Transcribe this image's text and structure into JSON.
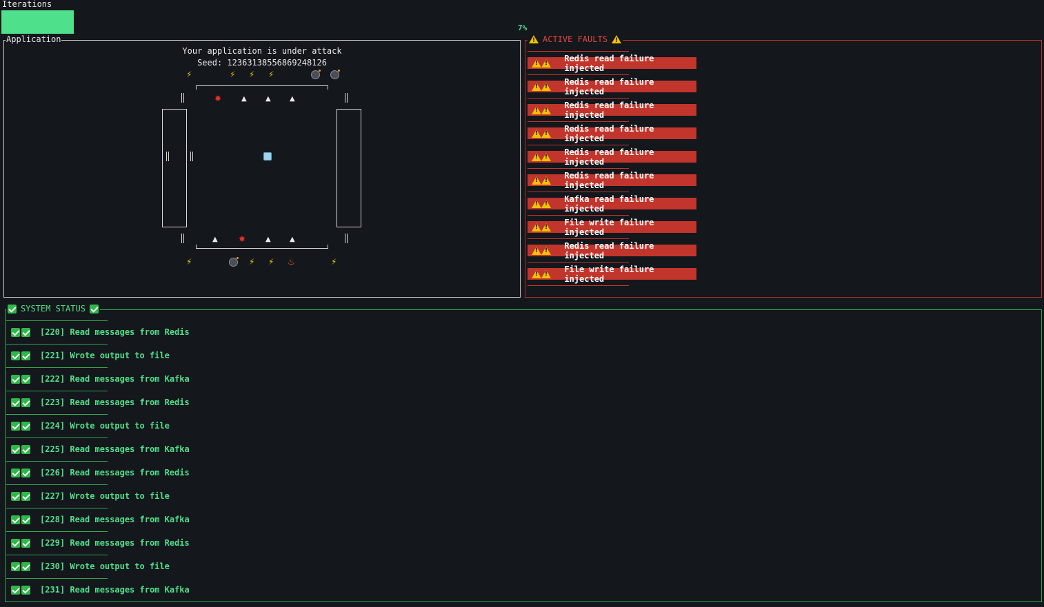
{
  "header": {
    "iterations_label": "Iterations",
    "progress_percent": "7%",
    "progress_fraction": 0.07
  },
  "application": {
    "title": "Application",
    "attack_message": "Your application is under attack",
    "seed_line": "Seed: 12363138556869248126"
  },
  "faults": {
    "title": "ACTIVE FAULTS",
    "items": [
      {
        "label": "Redis read failure injected"
      },
      {
        "label": "Redis read failure injected"
      },
      {
        "label": "Redis read failure injected"
      },
      {
        "label": "Redis read failure injected"
      },
      {
        "label": "Redis read failure injected"
      },
      {
        "label": "Redis read failure injected"
      },
      {
        "label": "Kafka read failure injected"
      },
      {
        "label": "File write failure injected"
      },
      {
        "label": "Redis read failure injected"
      },
      {
        "label": "File write failure injected"
      }
    ]
  },
  "status": {
    "title": "SYSTEM STATUS",
    "items": [
      {
        "label": "[220] Read messages from Redis"
      },
      {
        "label": "[221] Wrote output to file"
      },
      {
        "label": "[222] Read messages from Kafka"
      },
      {
        "label": "[223] Read messages from Redis"
      },
      {
        "label": "[224] Wrote output to file"
      },
      {
        "label": "[225] Read messages from Kafka"
      },
      {
        "label": "[226] Read messages from Redis"
      },
      {
        "label": "[227] Wrote output to file"
      },
      {
        "label": "[228] Read messages from Kafka"
      },
      {
        "label": "[229] Read messages from Redis"
      },
      {
        "label": "[230] Wrote output to file"
      },
      {
        "label": "[231] Read messages from Kafka"
      }
    ]
  },
  "colors": {
    "background": "#14171c",
    "ok_green": "#4fe08c",
    "fault_red": "#c2352c",
    "warning_yellow": "#f2c200"
  },
  "icons": {
    "fault_item_icon": "warning-icon",
    "status_item_icon": "check-icon",
    "arena_sprites": [
      "lightning-icon",
      "bomb-icon",
      "triangle-icon",
      "burst-icon",
      "fire-icon",
      "robot-icon"
    ]
  }
}
